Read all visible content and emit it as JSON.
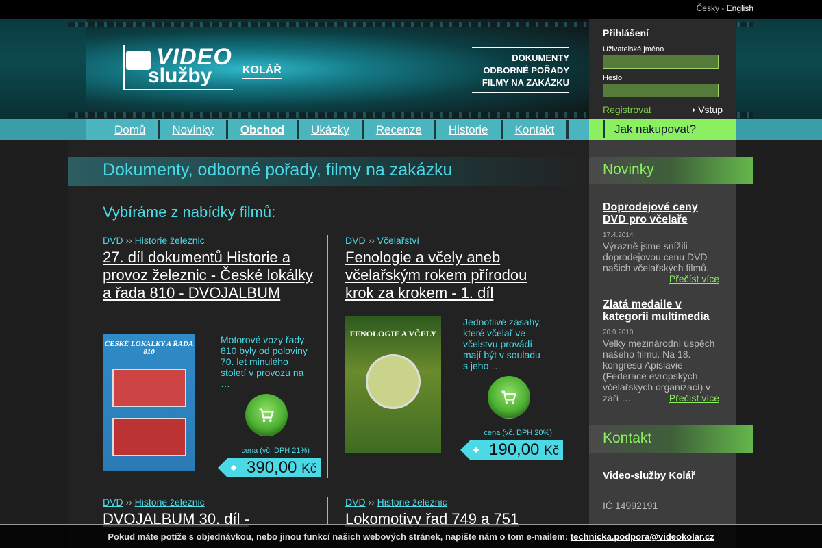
{
  "lang": {
    "current": "Česky",
    "separator": " - ",
    "other": "English"
  },
  "logo": {
    "video": "VIDEO",
    "sluzby": "služby",
    "kolar": "KOLÁŘ"
  },
  "tagline": [
    "DOKUMENTY",
    "ODBORNÉ POŘADY",
    "FILMY NA ZAKÁZKU"
  ],
  "login": {
    "title": "Přihlášení",
    "user_label": "Uživatelské jméno",
    "pass_label": "Heslo",
    "register": "Registrovat",
    "enter": "➝ Vstup"
  },
  "nav": [
    "Domů",
    "Novinky",
    "Obchod",
    "Ukázky",
    "Recenze",
    "Historie",
    "Kontakt"
  ],
  "howbuy": "Jak nakupovat?",
  "main": {
    "title": "Dokumenty, odborné pořady, filmy na zakázku",
    "subtitle": "Vybíráme z nabídky filmů:"
  },
  "products": [
    {
      "cat1": "DVD",
      "sep": " ›› ",
      "cat2": "Historie železnic",
      "title": "27. díl dokumentů Historie a provoz železnic - České lokálky a řada 810 - DVOJALBUM",
      "cover_title": "ČESKÉ LOKÁLKY A ŘADA 810",
      "desc": "Motorové vozy řady 810 byly od poloviny 70. let minulého století v provozu na …",
      "vat": "cena (vč. DPH 21%)",
      "price": "390,00",
      "currency": "Kč"
    },
    {
      "cat1": "DVD",
      "sep": " ›› ",
      "cat2": "Včelařství",
      "title": "Fenologie a včely aneb včelařským rokem přírodou krok za krokem - 1. díl",
      "cover_title": "FENOLOGIE A VČELY",
      "desc": "Jednotlivé zásahy, které včelař ve včelstvu provádí mají být v souladu s jeho …",
      "vat": "cena (vč. DPH 20%)",
      "price": "190,00",
      "currency": "Kč"
    },
    {
      "cat1": "DVD",
      "sep": " ›› ",
      "cat2": "Historie železnic",
      "title": "DVOJALBUM 30. díl -"
    },
    {
      "cat1": "DVD",
      "sep": " ›› ",
      "cat2": "Historie železnic",
      "title": "Lokomotivy řad 749 a 751"
    }
  ],
  "sidebar": {
    "news_title": "Novinky",
    "news": [
      {
        "title": "Doprodejové ceny DVD pro včelaře",
        "date": "17.4.2014",
        "text": "Výrazně jsme snížili doprodejovou cenu DVD našich včelařských filmů.",
        "more": "Přečíst více"
      },
      {
        "title": "Zlatá medaile v kategorii multimedia",
        "date": "20.9.2010",
        "text": "Velký mezinárodní úspěch našeho filmu. Na 18. kongresu Apislavie (Federace evropských včelařských organizací) v září …",
        "more": "Přečíst více"
      }
    ],
    "contact_title": "Kontakt",
    "company": "Video-služby Kolář",
    "ic": "IČ 14992191"
  },
  "notice": {
    "text": "Pokud máte potíže s objednávkou, nebo jinou funkcí našich webových stránek, napište nám o tom e-mailem:",
    "email": "technicka.podpora@videokolar.cz"
  }
}
